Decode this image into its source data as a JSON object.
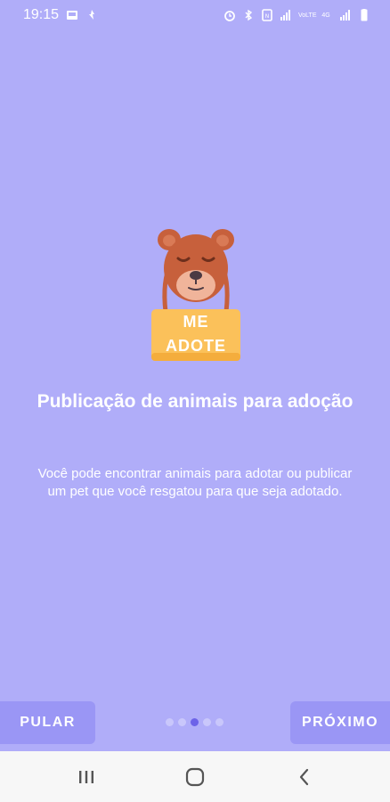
{
  "status_bar": {
    "time": "19:15",
    "left_icons": [
      "gallery-icon",
      "notification-icon"
    ],
    "right_icons": [
      "alarm-icon",
      "bluetooth-icon",
      "nfc-icon",
      "signal-icon",
      "signal-icon",
      "signal-icon",
      "battery-icon"
    ],
    "network_labels": [
      "VoLTE",
      "4G"
    ]
  },
  "illustration": {
    "sign_line1": "ME",
    "sign_line2": "ADOTE",
    "colors": {
      "dog_fur": "#c7603c",
      "dog_muzzle": "#f0b49a",
      "strap": "#c7603c",
      "sign": "#fbc15a"
    }
  },
  "content": {
    "title": "Publicação de animais para adoção",
    "description": "Você pode encontrar animais para adotar ou publicar um pet que você resgatou para que seja adotado."
  },
  "footer": {
    "skip_label": "PULAR",
    "next_label": "PRÓXIMO",
    "page_count": 5,
    "active_page": 3
  },
  "nav_bar": {
    "buttons": [
      "recents-icon",
      "home-icon",
      "back-icon"
    ]
  },
  "colors": {
    "background": "#b0adf9",
    "button_bg": "#9a96f5",
    "dot_inactive": "#c9c7fb",
    "dot_active": "#6d63e8",
    "nav_bg": "#f7f7f7"
  }
}
